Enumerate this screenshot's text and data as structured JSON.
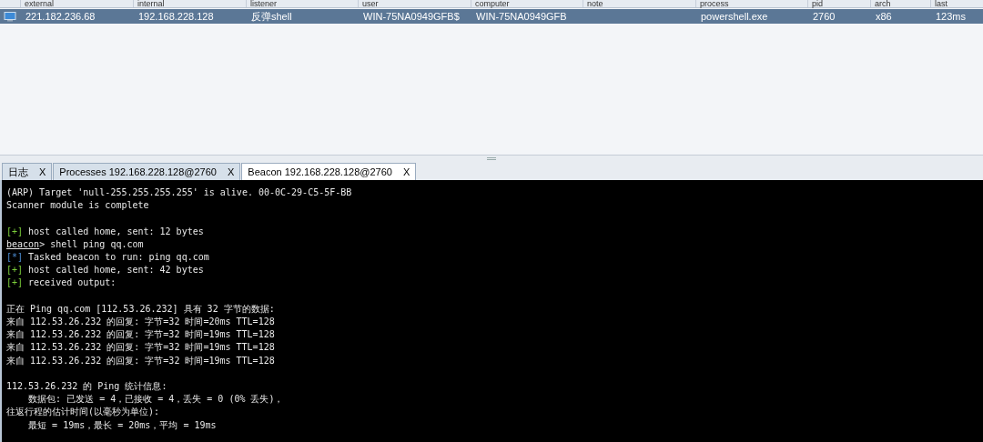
{
  "table": {
    "columns": [
      "external",
      "internal",
      "listener",
      "user",
      "computer",
      "note",
      "process",
      "pid",
      "arch",
      "last"
    ],
    "rows": [
      {
        "selected": true,
        "cells": [
          "221.182.236.68",
          "192.168.228.128",
          "反弹shell",
          "WIN-75NA0949GFB$",
          "WIN-75NA0949GFB",
          "",
          "powershell.exe",
          "2760",
          "x86",
          "123ms"
        ]
      }
    ]
  },
  "tabs": [
    {
      "label": "日志",
      "close": "X",
      "selected": false
    },
    {
      "label": "Processes 192.168.228.128@2760",
      "close": "X",
      "selected": false
    },
    {
      "label": "Beacon 192.168.228.128@2760",
      "close": "X",
      "selected": true
    }
  ],
  "console": [
    {
      "kind": "text",
      "text": "(ARP) Target 'null-255.255.255.255' is alive. 00-0C-29-C5-5F-BB"
    },
    {
      "kind": "text",
      "text": "Scanner module is complete"
    },
    {
      "kind": "blank"
    },
    {
      "kind": "plus",
      "tag": "[+]",
      "text": "host called home, sent: 12 bytes"
    },
    {
      "kind": "prompt",
      "prompt": "beacon",
      "text": "> shell ping qq.com"
    },
    {
      "kind": "star",
      "tag": "[*]",
      "text": "Tasked beacon to run: ping qq.com"
    },
    {
      "kind": "plus",
      "tag": "[+]",
      "text": "host called home, sent: 42 bytes"
    },
    {
      "kind": "plus",
      "tag": "[+]",
      "text": "received output:"
    },
    {
      "kind": "blank"
    },
    {
      "kind": "text",
      "text": "正在 Ping qq.com [112.53.26.232] 具有 32 字节的数据:"
    },
    {
      "kind": "text",
      "text": "来自 112.53.26.232 的回复: 字节=32 时间=20ms TTL=128"
    },
    {
      "kind": "text",
      "text": "来自 112.53.26.232 的回复: 字节=32 时间=19ms TTL=128"
    },
    {
      "kind": "text",
      "text": "来自 112.53.26.232 的回复: 字节=32 时间=19ms TTL=128"
    },
    {
      "kind": "text",
      "text": "来自 112.53.26.232 的回复: 字节=32 时间=19ms TTL=128"
    },
    {
      "kind": "blank"
    },
    {
      "kind": "text",
      "text": "112.53.26.232 的 Ping 统计信息:"
    },
    {
      "kind": "text",
      "text": "    数据包: 已发送 = 4，已接收 = 4，丢失 = 0 (0% 丢失)，"
    },
    {
      "kind": "text",
      "text": "往返行程的估计时间(以毫秒为单位):"
    },
    {
      "kind": "text",
      "text": "    最短 = 19ms，最长 = 20ms，平均 = 19ms"
    }
  ]
}
